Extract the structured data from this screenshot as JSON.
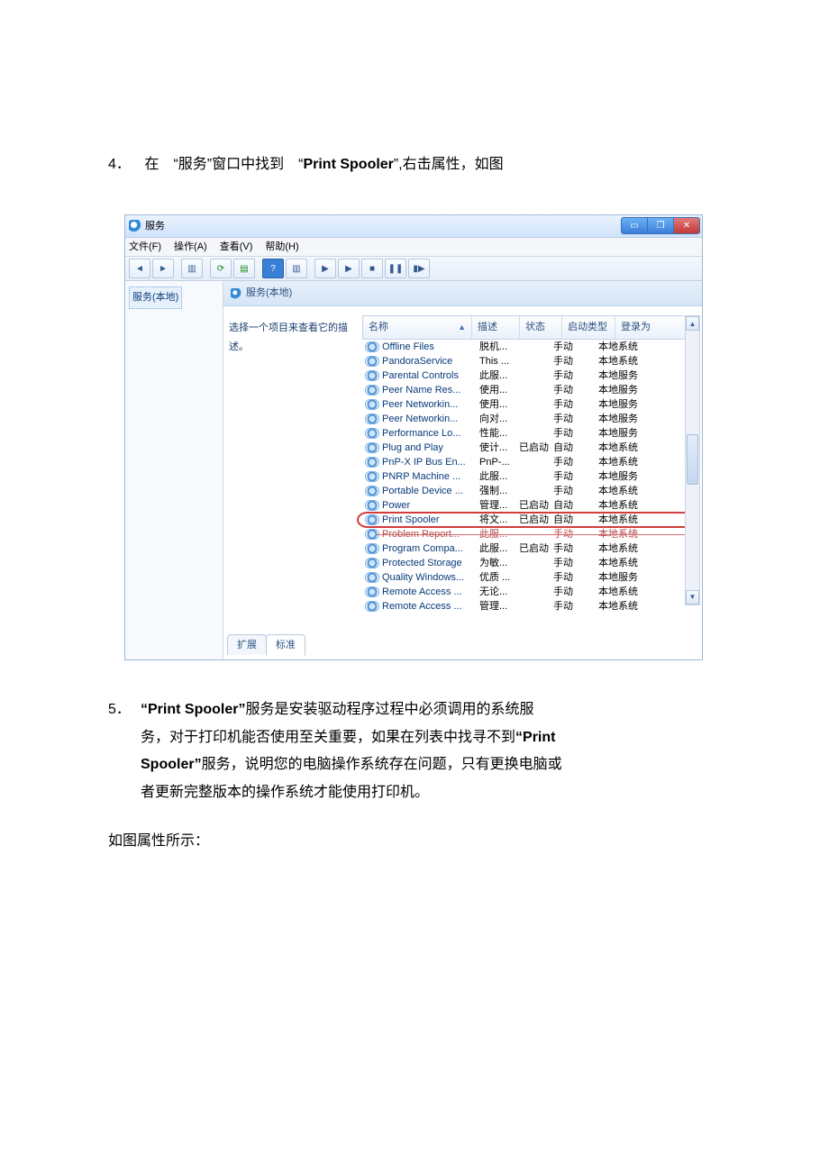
{
  "doc": {
    "step4_num": "4．",
    "step4_text_a": "在　“服务”窗口中找到　“",
    "step4_bold": "Print Spooler",
    "step4_text_b": "”,右击属性，如图",
    "step5_num": "5．",
    "step5_bold1": "“Print Spooler”",
    "step5_line1": "服务是安装驱动程序过程中必须调用的系统服",
    "step5_line2_a": "务，对于打印机能否使用至关重要，如果在列表中找寻不到",
    "step5_bold2": "“Print",
    "step5_line3_a": "Spooler”",
    "step5_line3_b": "服务，说明您的电脑操作系统存在问题，只有更换电脑或",
    "step5_line4": "者更新完整版本的操作系统才能使用打印机。",
    "footer": "如图属性所示："
  },
  "window": {
    "title": "服务",
    "menu": {
      "file": "文件(F)",
      "action": "操作(A)",
      "view": "查看(V)",
      "help": "帮助(H)"
    },
    "tree_root": "服务(本地)",
    "detail_title": "服务(本地)",
    "desc_prompt": "选择一个项目来查看它的描述。",
    "columns": {
      "name": "名称",
      "desc": "描述",
      "status": "状态",
      "start": "启动类型",
      "logon": "登录为"
    },
    "tabs": {
      "extended": "扩展",
      "standard": "标准"
    },
    "services": [
      {
        "name": "Offline Files",
        "desc": "脱机...",
        "status": "",
        "start": "手动",
        "logon": "本地系统"
      },
      {
        "name": "PandoraService",
        "desc": "This ...",
        "status": "",
        "start": "手动",
        "logon": "本地系统"
      },
      {
        "name": "Parental Controls",
        "desc": "此服...",
        "status": "",
        "start": "手动",
        "logon": "本地服务"
      },
      {
        "name": "Peer Name Res...",
        "desc": "使用...",
        "status": "",
        "start": "手动",
        "logon": "本地服务"
      },
      {
        "name": "Peer Networkin...",
        "desc": "使用...",
        "status": "",
        "start": "手动",
        "logon": "本地服务"
      },
      {
        "name": "Peer Networkin...",
        "desc": "向对...",
        "status": "",
        "start": "手动",
        "logon": "本地服务"
      },
      {
        "name": "Performance Lo...",
        "desc": "性能...",
        "status": "",
        "start": "手动",
        "logon": "本地服务"
      },
      {
        "name": "Plug and Play",
        "desc": "使计...",
        "status": "已启动",
        "start": "自动",
        "logon": "本地系统"
      },
      {
        "name": "PnP-X IP Bus En...",
        "desc": "PnP-...",
        "status": "",
        "start": "手动",
        "logon": "本地系统"
      },
      {
        "name": "PNRP Machine ...",
        "desc": "此服...",
        "status": "",
        "start": "手动",
        "logon": "本地服务"
      },
      {
        "name": "Portable Device ...",
        "desc": "强制...",
        "status": "",
        "start": "手动",
        "logon": "本地系统"
      },
      {
        "name": "Power",
        "desc": "管理...",
        "status": "已启动",
        "start": "自动",
        "logon": "本地系统"
      },
      {
        "name": "Print Spooler",
        "desc": "将文...",
        "status": "已启动",
        "start": "自动",
        "logon": "本地系统",
        "highlight": true
      },
      {
        "name": "Problem Report...",
        "desc": "此服...",
        "status": "",
        "start": "手动",
        "logon": "本地系统",
        "strike": true
      },
      {
        "name": "Program Compa...",
        "desc": "此服...",
        "status": "已启动",
        "start": "手动",
        "logon": "本地系统"
      },
      {
        "name": "Protected Storage",
        "desc": "为敏...",
        "status": "",
        "start": "手动",
        "logon": "本地系统"
      },
      {
        "name": "Quality Windows...",
        "desc": "优质 ...",
        "status": "",
        "start": "手动",
        "logon": "本地服务"
      },
      {
        "name": "Remote Access ...",
        "desc": "无论...",
        "status": "",
        "start": "手动",
        "logon": "本地系统"
      },
      {
        "name": "Remote Access ...",
        "desc": "管理...",
        "status": "",
        "start": "手动",
        "logon": "本地系统"
      }
    ]
  }
}
